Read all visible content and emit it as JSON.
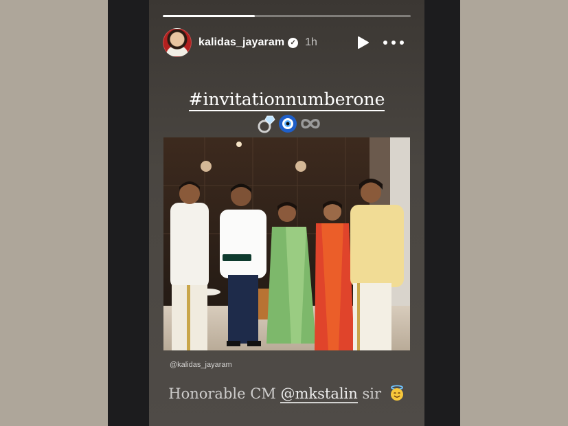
{
  "story": {
    "progress_fraction": 0.37,
    "username": "kalidas_jayaram",
    "time_ago": "1h",
    "hashtag": "#invitationnumberone",
    "emojis": [
      "ring-emoji",
      "nazar-amulet-emoji",
      "infinity-emoji"
    ],
    "photo_credit": "@kalidas_jayaram",
    "caption_prefix": "Honorable CM",
    "caption_mention": "@mkstalin",
    "caption_suffix": "sir",
    "caption_emoji": "smiling-face-with-halo-emoji"
  },
  "colors": {
    "page_bg": "#aea69a",
    "frame_bg": "#1c1c1e",
    "story_bg_top": "#3b3733",
    "story_bg_bottom": "#4f4b47"
  }
}
